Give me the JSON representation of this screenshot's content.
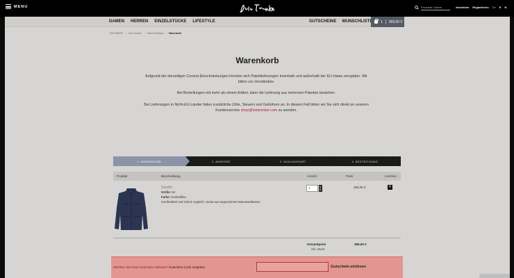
{
  "topbar": {
    "menu_label": "MENU",
    "logo_text": "Luis Trenker",
    "search_placeholder": "Produkte / Name",
    "login": "Anmelden",
    "register": "Registrieren",
    "lang_de": "De",
    "lang_en": "E",
    "lang_n": "N"
  },
  "nav": {
    "left": [
      "DAMEN",
      "HERREN",
      "EINZELSTÜCKE",
      "LIFESTYLE"
    ],
    "right": [
      "GUTSCHEINE",
      "WUNSCHLISTE"
    ],
    "cart_count": "1",
    "cart_total": "359,00 €"
  },
  "breadcrumb": [
    "DIE MARKE",
    "Luis Trenker",
    "Online-Boutique",
    "Warenkorb"
  ],
  "main": {
    "title": "Warenkorb",
    "para1": "Aufgrund der derzeitigen Corona-Einschränkungen könnten sich Paketlieferungen innerhalb und außerhalb der EU etwas verspäten. Wir bitten um Verständnis.",
    "para2": "Bei Bestellungen mit mehr als einem Artikel, kann die Lieferung aus mehreren Paketen bestehen.",
    "para3_a": "Bei Lieferungen in Nicht-EU-Länder fallen zusätzliche Zölle, Steuern und Gebühren an. In diesem Fall bitten wir Sie sich direkt an unseren Kundenservice",
    "para3_email": "shop@luistrenker.com",
    "para3_b": "zu wenden."
  },
  "steps": [
    "1. WARENKORB",
    "2. ADRESSE",
    "3. ZAHLUNGSART",
    "4. BESTÄTIGUNG"
  ],
  "table": {
    "headers": {
      "product": "Produkt",
      "description": "Beschreibung",
      "quantity": "Anzahl",
      "price": "Preis",
      "delete": "Löschen"
    },
    "item": {
      "name": "Sandro",
      "size_label": "Größe:",
      "size_value": "60",
      "color_label": "Farbe:",
      "color_value": "Dunkelblau",
      "description": "Komfortabel und schick zugleich: Jacke aus angenehmem Baumwollsweat",
      "quantity": "1",
      "price": "359,00 €",
      "remove": "×"
    },
    "total_label": "Gesamtpreis",
    "total_value": "359,00 €",
    "vat_note": "inkl. MwSt"
  },
  "voucher": {
    "question": "Möchten Sie Ihren Gutschein einlösen?",
    "link": "Gutschein-Code eingeben",
    "button": "Gutschein einlösen"
  },
  "colors": {
    "accent_red": "#b01d3a",
    "active_step": "#8b93a6",
    "voucher_bg": "#e39591"
  }
}
